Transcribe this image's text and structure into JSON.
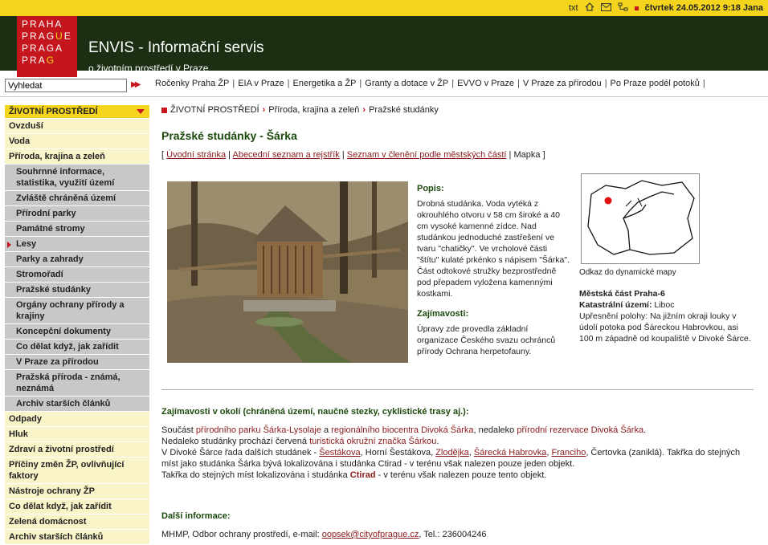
{
  "logo": {
    "lines": [
      [
        "P",
        "R",
        "A",
        "H",
        "A"
      ],
      [
        "P",
        "R",
        "A",
        "G",
        "U",
        "E"
      ],
      [
        "P",
        "R",
        "A",
        "G",
        "A"
      ],
      [
        "P",
        "R",
        "A",
        "G"
      ]
    ]
  },
  "toplinks": {
    "txt": "txt",
    "date": "čtvrtek 24.05.2012 9:18 Jana",
    "icons": [
      "home-icon",
      "mail-icon",
      "sitemap-icon"
    ]
  },
  "header": {
    "title": "ENVIS - Informační servis",
    "subtitle": "o životním prostředí v Praze"
  },
  "search": {
    "value": "Vyhledat",
    "button": "▶▶"
  },
  "nav": [
    "Ročenky Praha ŽP",
    "EIA v Praze",
    "Energetika a ŽP",
    "Granty a dotace v ŽP",
    "EVVO v Praze",
    "V Praze za přírodou",
    "Po Praze podél potoků"
  ],
  "sidebar": {
    "head": "ŽIVOTNÍ PROSTŘEDÍ",
    "items": [
      {
        "label": "Ovzduší",
        "level": 1
      },
      {
        "label": "Voda",
        "level": 1
      },
      {
        "label": "Příroda, krajina a zeleň",
        "level": 1
      },
      {
        "label": "Souhrnné informace, statistika, využití území",
        "level": 2
      },
      {
        "label": "Zvláště chráněná území",
        "level": 2
      },
      {
        "label": "Přírodní parky",
        "level": 2
      },
      {
        "label": "Památné stromy",
        "level": 2
      },
      {
        "label": "Lesy",
        "level": 2,
        "active": true
      },
      {
        "label": "Parky a zahrady",
        "level": 2
      },
      {
        "label": "Stromořadí",
        "level": 2
      },
      {
        "label": "Pražské studánky",
        "level": 2
      },
      {
        "label": "Orgány ochrany přírody a krajiny",
        "level": 2
      },
      {
        "label": "Koncepční dokumenty",
        "level": 2
      },
      {
        "label": "Co dělat když, jak zařídit",
        "level": 2
      },
      {
        "label": "V Praze za přírodou",
        "level": 2
      },
      {
        "label": "Pražská příroda - známá, neznámá",
        "level": 2
      },
      {
        "label": "Archiv starších článků",
        "level": 2
      },
      {
        "label": "Odpady",
        "level": 1
      },
      {
        "label": "Hluk",
        "level": 1
      },
      {
        "label": "Zdraví a životní prostředí",
        "level": 1
      },
      {
        "label": "Příčiny změn ŽP, ovlivňující faktory",
        "level": 1
      },
      {
        "label": "Nástroje ochrany ŽP",
        "level": 1
      },
      {
        "label": "Co dělat když, jak zařídit",
        "level": 1
      },
      {
        "label": "Zelená domácnost",
        "level": 1
      },
      {
        "label": "Archiv starších článků",
        "level": 1
      }
    ]
  },
  "breadcrumb": [
    "ŽIVOTNÍ PROSTŘEDÍ",
    "Příroda, krajina a zeleň",
    "Pražské studánky"
  ],
  "page": {
    "title": "Pražské studánky - Šárka",
    "sublinks": {
      "open": "[",
      "l1": "Úvodní stránka",
      "sep": "|",
      "l2": "Abecední seznam a rejstřík",
      "l3": "Seznam v členění podle městských částí",
      "mapka": "Mapka",
      "close": "]"
    },
    "popis_title": "Popis:",
    "popis": "Drobná studánka. Voda vytéká z okrouhlého otvoru v 58 cm široké a 40 cm vysoké kamenné zídce. Nad studánkou jednoduché zastřešení ve tvaru \"chatičky\". Ve vrcholové části \"štítu\" kulaté prkénko s nápisem \"Šárka\". Část odtokové stružky bezprostředně pod přepadem vyložena kamennými kostkami.",
    "zaj_title": "Zajímavosti:",
    "zaj": "Úpravy zde provedla základní organizace Českého svazu ochránců přírody Ochrana herpetofauny.",
    "map_caption": "Odkaz do dynamické mapy",
    "mesto_label": "Městská část Praha-6",
    "katastr_label": "Katastrální území:",
    "katastr_value": "Liboc",
    "poloha": "Upřesnění polohy: Na jižním okraji louky v údolí potoka pod Šáreckou Habrovkou, asi 100 m západně od koupaliště v Divoké Šárce."
  },
  "okoli": {
    "title": "Zajímavosti v okolí (chráněná území, naučné stezky, cyklistické trasy aj.):",
    "p1a": "Součást ",
    "p1b": "přírodního parku Šárka-Lysolaje",
    "p1c": " a ",
    "p1d": "regionálního biocentra Divoká Šárka",
    "p1e": ", nedaleko ",
    "p1f": "přírodní rezervace Divoká Šárka",
    "p1g": ".",
    "p2a": "Nedaleko studánky prochází červená ",
    "p2b": "turistická okružní značka Šárkou",
    "p2c": ".",
    "p3a": "V Divoké Šárce řada dalších studánek - ",
    "links": [
      "Šestákova",
      "Zlodějka",
      "Šárecká Habrovka",
      "Franciho"
    ],
    "p3b": ", Horní Šestákova, ",
    "p3c": ", ",
    "p3d": ", ",
    "p3e": ", Čertovka (zaniklá). Takřka do stejných míst jako studánka Šárka bývá lokalizována i studánka Ctirad - v terénu však nalezen pouze jeden objekt.",
    "p4a": "Takřka do stejných míst lokalizována i studánka ",
    "p4b": "Ctirad",
    "p4c": " - v terénu však nalezen pouze tento objekt."
  },
  "dalsi": {
    "title": "Další informace:",
    "a": "MHMP, Odbor ochrany prostředí, e-mail: ",
    "email": "oopsek@cityofprague.cz",
    "b": ", Tel.: 236004246"
  }
}
